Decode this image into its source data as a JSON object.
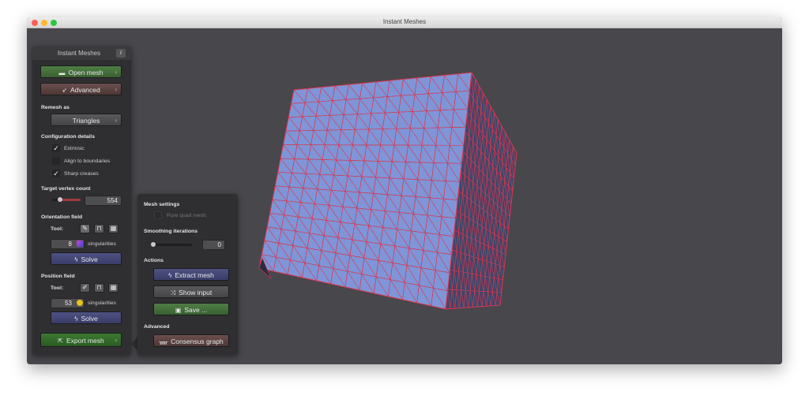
{
  "window": {
    "title": "Instant Meshes"
  },
  "panel": {
    "title": "Instant Meshes",
    "info_icon": "i",
    "open_mesh": "Open mesh",
    "advanced": "Advanced",
    "remesh_as_label": "Remesh as",
    "remesh_as_value": "Triangles",
    "config_label": "Configuration details",
    "config_items": [
      {
        "label": "Extrinsic",
        "checked": true
      },
      {
        "label": "Align to boundaries",
        "checked": false
      },
      {
        "label": "Sharp creases",
        "checked": true
      }
    ],
    "target_label": "Target vertex count",
    "target_value": "554",
    "orientation": {
      "label": "Orientation field",
      "tool_label": "Tool:",
      "singularities_value": "8",
      "singularities_label": "singularities",
      "solve": "Solve"
    },
    "position": {
      "label": "Position field",
      "tool_label": "Tool:",
      "singularities_value": "53",
      "singularities_label": "singularities",
      "solve": "Solve"
    },
    "export_mesh": "Export mesh"
  },
  "subpanel": {
    "mesh_settings_label": "Mesh settings",
    "pure_quad": {
      "label": "Pure quad mesh",
      "checked": false
    },
    "smoothing_label": "Smoothing iterations",
    "smoothing_value": "0",
    "actions_label": "Actions",
    "extract_mesh": "Extract mesh",
    "show_input": "Show input",
    "save": "Save ...",
    "advanced_label": "Advanced",
    "consensus_graph": "Consensus graph"
  },
  "icons": {
    "chevron": "›",
    "folder": "▬",
    "rocket": "➶",
    "bolt": "ϟ",
    "shuffle": "⤨",
    "floppy": "▣",
    "sitemap": "ᚅ",
    "share": "⇱",
    "brush": "✎",
    "comb": "⊓",
    "pen": "✐",
    "check": "✓"
  },
  "colors": {
    "mesh_face": "#7f95d8",
    "mesh_edge": "#d8374e",
    "viewport_bg": "#48474c",
    "target_slider_fill": 0.1,
    "smoothing_slider_fill": 0.0
  }
}
